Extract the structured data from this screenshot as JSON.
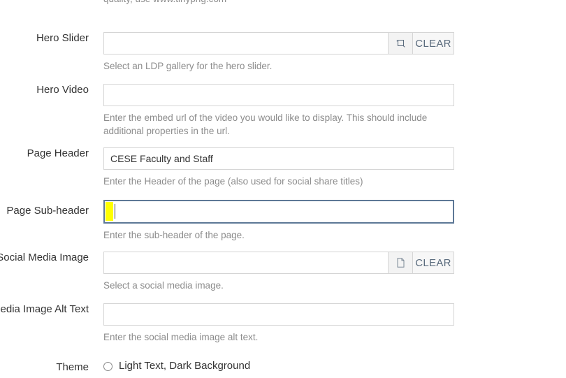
{
  "top_truncated_help": "quality, use www.tinypng.com",
  "fields": [
    {
      "label": "Hero Slider",
      "value": "",
      "help": "Select an LDP gallery for the hero slider.",
      "icon": "gallery-frame-icon",
      "clear_label": "CLEAR"
    },
    {
      "label": "Hero Video",
      "value": "",
      "help": "Enter the embed url of the video you would like to display. This should include additional properties in the url."
    },
    {
      "label": "Page Header",
      "value": "CESE Faculty and Staff",
      "help": "Enter the Header of the page (also used for social share titles)"
    },
    {
      "label": "Page Sub-header",
      "value": "",
      "help": "Enter the sub-header of the page."
    },
    {
      "label": "Social Media Image",
      "value": "",
      "help": "Select a social media image.",
      "icon": "document-file-icon",
      "clear_label": "CLEAR"
    },
    {
      "label": "Social Media Image Alt Text",
      "value": "",
      "help": "Enter the social media image alt text."
    }
  ],
  "theme": {
    "label": "Theme",
    "option_label": "Light Text, Dark Background",
    "checked": false
  },
  "colors": {
    "focus_border": "#5d7896",
    "highlight": "#ffff00",
    "help_text": "#8c8c8c",
    "border": "#d5d5d5",
    "clear_text": "#5a6b7d"
  }
}
